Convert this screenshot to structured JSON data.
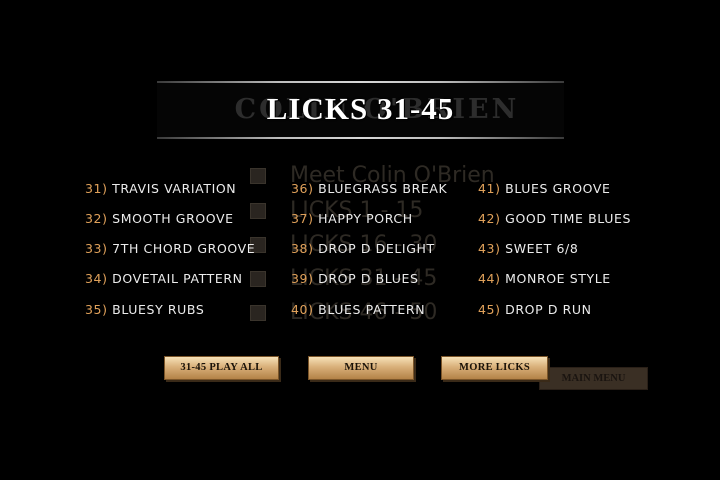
{
  "banner": {
    "title": "LICKS 31-45",
    "ghost_title": "COLIN O'BRIEN"
  },
  "ghost_menu": [
    {
      "label": "Meet Colin O'Brien"
    },
    {
      "label": "LICKS 1 - 15"
    },
    {
      "label": "LICKS 16 - 30"
    },
    {
      "label": "LICKS 31 - 45"
    },
    {
      "label": "LICKS 46 - 50"
    }
  ],
  "licks": [
    {
      "num": "31)",
      "name": "TRAVIS VARIATION"
    },
    {
      "num": "32)",
      "name": "SMOOTH GROOVE"
    },
    {
      "num": "33)",
      "name": "7TH CHORD GROOVE"
    },
    {
      "num": "34)",
      "name": "DOVETAIL PATTERN"
    },
    {
      "num": "35)",
      "name": "BLUESY RUBS"
    },
    {
      "num": "36)",
      "name": "BLUEGRASS BREAK"
    },
    {
      "num": "37)",
      "name": "HAPPY PORCH"
    },
    {
      "num": "38)",
      "name": "DROP D DELIGHT"
    },
    {
      "num": "39)",
      "name": "DROP D BLUES"
    },
    {
      "num": "40)",
      "name": "BLUES PATTERN"
    },
    {
      "num": "41)",
      "name": "BLUES GROOVE"
    },
    {
      "num": "42)",
      "name": "GOOD TIME BLUES"
    },
    {
      "num": "43)",
      "name": "SWEET 6/8"
    },
    {
      "num": "44)",
      "name": "MONROE STYLE"
    },
    {
      "num": "45)",
      "name": "DROP D RUN"
    }
  ],
  "buttons": {
    "play_all": "31-45 PLAY ALL",
    "menu": "MENU",
    "more_licks": "MORE LICKS",
    "main_menu": "MAIN MENU"
  },
  "colors": {
    "background": "#000000",
    "number": "#e0a15a",
    "text": "#ececec",
    "button_gold": "#d9b07a"
  }
}
